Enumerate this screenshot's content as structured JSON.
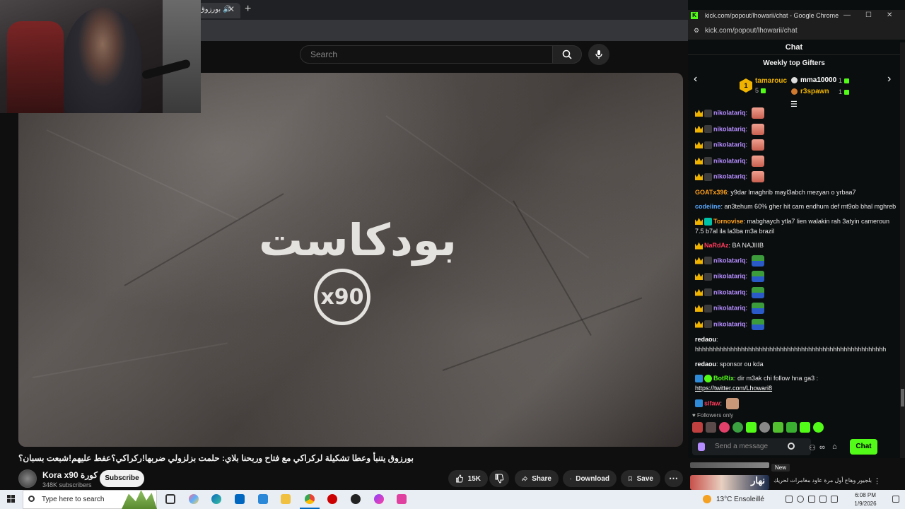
{
  "youtube": {
    "tab_title": "بورزوق",
    "search_placeholder": "Search",
    "video_title": "بورزوق يتنبأ وعطا تشكيلة لركراكي مع فتاح وربحنا بلاي: حلمت بزلزولي ضربها!ركراكي؟عفط عليهم!شبعت بسبان؟",
    "logo_text": "بودكاست",
    "logo_badge": "x90",
    "channel_name": "Kora x90 كورة",
    "channel_subs": "348K subscribers",
    "subscribe_label": "Subscribe",
    "like_count": "15K",
    "share_label": "Share",
    "download_label": "Download",
    "save_label": "Save"
  },
  "kick": {
    "window_title": "kick.com/popout/lhowarii/chat - Google Chrome",
    "url": "kick.com/popout/lhowarii/chat",
    "header": "Chat",
    "gifters_title": "Weekly top Gifters",
    "gifters": [
      {
        "rank": "1",
        "name": "tamarouc",
        "count": "5"
      },
      {
        "name": "mma10000",
        "count": "1"
      },
      {
        "name": "r3spawn",
        "count": "1"
      }
    ],
    "followers_only": "Followers only",
    "input_placeholder": "Send a message",
    "chat_button": "Chat",
    "news_badge": "New",
    "news_text": "بلجيور وهاج أول مرة عاود مغامرات لحريك",
    "news_thumb": "نهار",
    "colors": {
      "accent": "#53fc18",
      "gold": "#f0b400"
    }
  },
  "chat": [
    {
      "user": "nikolatariq",
      "text": ""
    },
    {
      "user": "nikolatariq",
      "text": ""
    },
    {
      "user": "nikolatariq",
      "text": ""
    },
    {
      "user": "nikolatariq",
      "text": ""
    },
    {
      "user": "nikolatariq",
      "text": ""
    },
    {
      "user": "GOATx396",
      "text": "y9dar lmaghrib mayl3abch mezyan o yrbaa7"
    },
    {
      "user": "codeiine",
      "text": "an3tehum 60% gher hit cam endhum def mt9ob bhal mghreb"
    },
    {
      "user": "Tornovise",
      "text": "mabghaych ytla7 lien walakin rah 3atyin cameroun 7.5 b7al ila la3ba m3a brazil"
    },
    {
      "user": "NaRdAz",
      "text": "BA NAJIIIB"
    },
    {
      "user": "nikolatariq",
      "text": ""
    },
    {
      "user": "nikolatariq",
      "text": ""
    },
    {
      "user": "nikolatariq",
      "text": ""
    },
    {
      "user": "nikolatariq",
      "text": ""
    },
    {
      "user": "nikolatariq",
      "text": ""
    },
    {
      "user": "redaou",
      "text": "hhhhhhhhhhhhhhhhhhhhhhhhhhhhhhhhhhhhhhhhhhhhhhhhhhhhhh"
    },
    {
      "user": "redaou",
      "text": "sponsor ou kda"
    },
    {
      "user": "BotRix",
      "text": "dir m3ak chi follow hna ga3 :",
      "link": "https://twitter.com/Lhowari8"
    },
    {
      "user": "sifaw",
      "text": ""
    }
  ],
  "taskbar": {
    "search_placeholder": "Type here to search",
    "weather": "13°C  Ensoleillé",
    "time": "6:08 PM",
    "date": "1/9/2026"
  }
}
